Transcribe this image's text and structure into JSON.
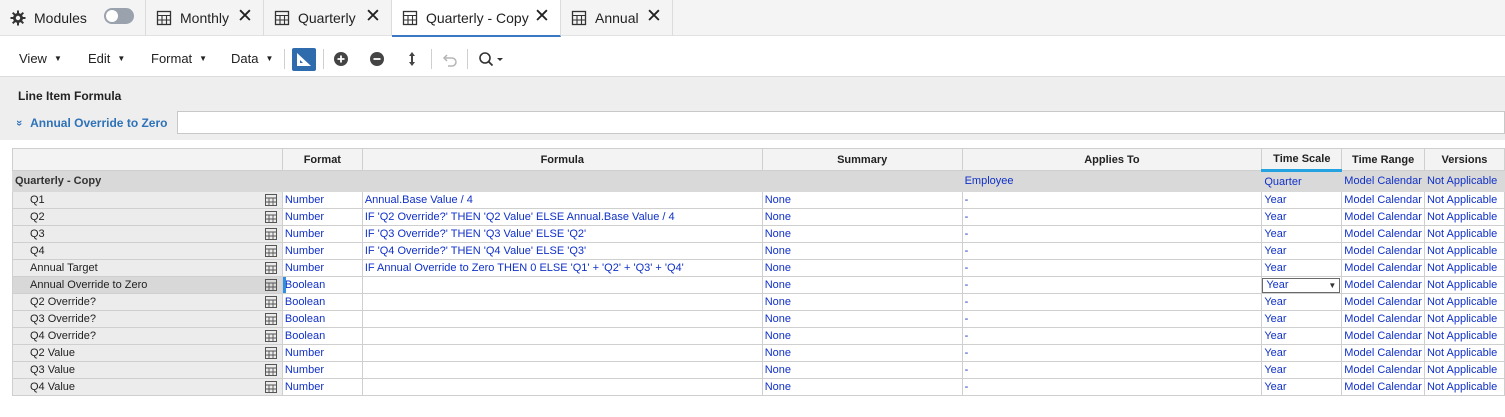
{
  "tabs": {
    "modules_label": "Modules",
    "monthly_label": "Monthly",
    "quarterly_label": "Quarterly",
    "quarterly_copy_label": "Quarterly - Copy",
    "annual_label": "Annual",
    "close_glyph": "✕"
  },
  "toolbar": {
    "view_label": "View",
    "edit_label": "Edit",
    "format_label": "Format",
    "data_label": "Data",
    "caret": "▼",
    "icons": [
      "blueprint-icon",
      "add-icon",
      "remove-icon",
      "move-icon",
      "undo-icon",
      "search-icon"
    ]
  },
  "formula_bar": {
    "title": "Line Item Formula",
    "line_item": "Annual Override to Zero",
    "chevron": "»",
    "value": ""
  },
  "grid": {
    "columns": {
      "format": "Format",
      "formula": "Formula",
      "summary": "Summary",
      "applies_to": "Applies To",
      "time_scale": "Time Scale",
      "time_range": "Time Range",
      "versions": "Versions"
    },
    "group": {
      "name": "Quarterly - Copy",
      "applies_to": "Employee",
      "time_scale": "Quarter",
      "time_range": "Model Calendar",
      "versions": "Not Applicable"
    },
    "rows": [
      {
        "name": "Q1",
        "format": "Number",
        "formula": "Annual.Base Value / 4",
        "summary": "None",
        "applies_to": "-",
        "time_scale": "Year",
        "time_range": "Model Calendar",
        "versions": "Not Applicable"
      },
      {
        "name": "Q2",
        "format": "Number",
        "formula": "IF 'Q2 Override?' THEN 'Q2 Value' ELSE Annual.Base Value / 4",
        "summary": "None",
        "applies_to": "-",
        "time_scale": "Year",
        "time_range": "Model Calendar",
        "versions": "Not Applicable"
      },
      {
        "name": "Q3",
        "format": "Number",
        "formula": "IF 'Q3 Override?' THEN 'Q3 Value' ELSE 'Q2'",
        "summary": "None",
        "applies_to": "-",
        "time_scale": "Year",
        "time_range": "Model Calendar",
        "versions": "Not Applicable"
      },
      {
        "name": "Q4",
        "format": "Number",
        "formula": "IF 'Q4 Override?' THEN 'Q4 Value' ELSE 'Q3'",
        "summary": "None",
        "applies_to": "-",
        "time_scale": "Year",
        "time_range": "Model Calendar",
        "versions": "Not Applicable"
      },
      {
        "name": "Annual Target",
        "format": "Number",
        "formula": "IF Annual Override to Zero THEN 0 ELSE 'Q1' + 'Q2' + 'Q3' + 'Q4'",
        "summary": "None",
        "applies_to": "-",
        "time_scale": "Year",
        "time_range": "Model Calendar",
        "versions": "Not Applicable"
      },
      {
        "name": "Annual Override to Zero",
        "format": "Boolean",
        "formula": "",
        "summary": "None",
        "applies_to": "-",
        "time_scale": "Year",
        "time_range": "Model Calendar",
        "versions": "Not Applicable"
      },
      {
        "name": "Q2 Override?",
        "format": "Boolean",
        "formula": "",
        "summary": "None",
        "applies_to": "-",
        "time_scale": "Year",
        "time_range": "Model Calendar",
        "versions": "Not Applicable"
      },
      {
        "name": "Q3 Override?",
        "format": "Boolean",
        "formula": "",
        "summary": "None",
        "applies_to": "-",
        "time_scale": "Year",
        "time_range": "Model Calendar",
        "versions": "Not Applicable"
      },
      {
        "name": "Q4 Override?",
        "format": "Boolean",
        "formula": "",
        "summary": "None",
        "applies_to": "-",
        "time_scale": "Year",
        "time_range": "Model Calendar",
        "versions": "Not Applicable"
      },
      {
        "name": "Q2 Value",
        "format": "Number",
        "formula": "",
        "summary": "None",
        "applies_to": "-",
        "time_scale": "Year",
        "time_range": "Model Calendar",
        "versions": "Not Applicable"
      },
      {
        "name": "Q3 Value",
        "format": "Number",
        "formula": "",
        "summary": "None",
        "applies_to": "-",
        "time_scale": "Year",
        "time_range": "Model Calendar",
        "versions": "Not Applicable"
      },
      {
        "name": "Q4 Value",
        "format": "Number",
        "formula": "",
        "summary": "None",
        "applies_to": "-",
        "time_scale": "Year",
        "time_range": "Model Calendar",
        "versions": "Not Applicable"
      }
    ],
    "selected_row": 5,
    "dropdown_caret": "▼"
  },
  "colors": {
    "accent": "#2f6cae",
    "link_text": "#1030c8",
    "active_tab_underline": "#3a78c4",
    "sorted_header": "#24a3e0"
  }
}
